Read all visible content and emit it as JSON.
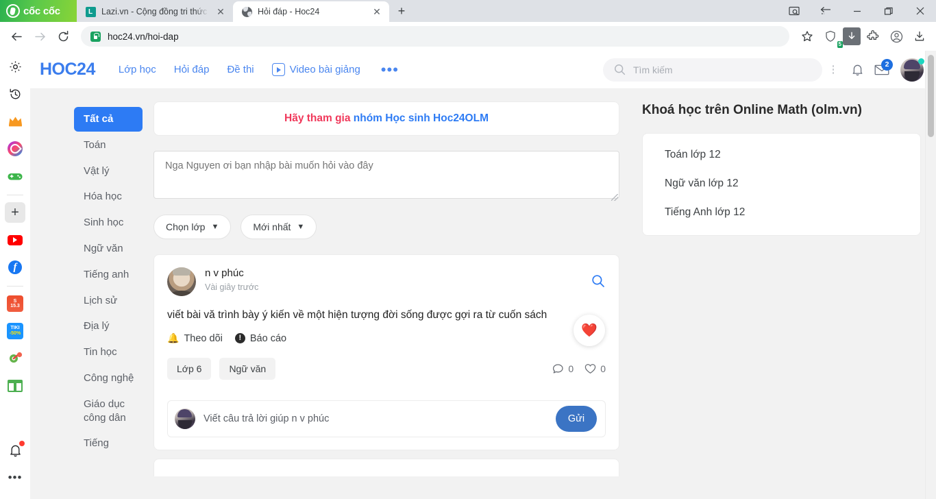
{
  "browser": {
    "logo_text": "cốc cốc",
    "tabs": [
      {
        "title": "Lazi.vn - Cộng đồng tri thức ",
        "favicon": "lazi-letter-icon",
        "active": false
      },
      {
        "title": "Hỏi đáp - Hoc24",
        "favicon": "globe-icon",
        "active": true
      }
    ],
    "new_tab_label": "+",
    "window_controls": [
      "screenshot-icon",
      "sync-icon",
      "minimize-icon",
      "maximize-icon",
      "close-icon"
    ],
    "toolbar": {
      "back_label": "←",
      "forward_label": "→",
      "reload_label": "⟳",
      "url": "hoc24.vn/hoi-dap",
      "shield_count": "5",
      "icons": [
        "bookmark-star-icon",
        "shield-icon",
        "download-icon",
        "extensions-icon",
        "profile-icon",
        "save-icon"
      ]
    }
  },
  "sidepanel": {
    "items": [
      {
        "name": "settings-icon",
        "glyph": "⚙"
      },
      {
        "name": "history-icon",
        "glyph": "↺"
      },
      {
        "name": "crown-icon",
        "glyph": "♛"
      },
      {
        "name": "messenger-icon",
        "glyph": ""
      },
      {
        "name": "game-icon",
        "glyph": "🎮"
      },
      {
        "name": "add-icon",
        "glyph": "+"
      },
      {
        "name": "youtube-icon",
        "glyph": ""
      },
      {
        "name": "facebook-icon",
        "glyph": "f"
      },
      {
        "name": "shopee-icon",
        "glyph": "15.3"
      },
      {
        "name": "tiki-icon",
        "glyph": "-50%"
      },
      {
        "name": "extension-icon",
        "glyph": "🧩"
      },
      {
        "name": "marketplace-icon",
        "glyph": ""
      },
      {
        "name": "notification-bell-icon",
        "glyph": "🔔"
      },
      {
        "name": "more-icon",
        "glyph": "•••"
      }
    ],
    "shopee_top": "S",
    "shopee_bottom": "15.3",
    "tiki_top": "TIKI",
    "tiki_bottom": "-50%"
  },
  "site": {
    "brand": "HOC24",
    "nav": [
      {
        "label": "Lớp học"
      },
      {
        "label": "Hỏi đáp"
      },
      {
        "label": "Đề thi"
      },
      {
        "label": "Video bài giảng",
        "icon": "play-icon"
      }
    ],
    "nav_more": "•••",
    "search_placeholder": "Tìm kiếm",
    "mail_badge": "2"
  },
  "subjects": {
    "items": [
      {
        "label": "Tất cả",
        "active": true
      },
      {
        "label": "Toán",
        "active": false
      },
      {
        "label": "Vật lý",
        "active": false
      },
      {
        "label": "Hóa học",
        "active": false
      },
      {
        "label": "Sinh học",
        "active": false
      },
      {
        "label": "Ngữ văn",
        "active": false
      },
      {
        "label": "Tiếng anh",
        "active": false
      },
      {
        "label": "Lịch sử",
        "active": false
      },
      {
        "label": "Địa lý",
        "active": false
      },
      {
        "label": "Tin học",
        "active": false
      },
      {
        "label": "Công nghệ",
        "active": false
      },
      {
        "label": "Giáo dục công dân",
        "active": false
      },
      {
        "label": "Tiếng",
        "active": false
      }
    ]
  },
  "main": {
    "promo_prefix": "Hãy tham gia ",
    "promo_link": "nhóm Học sinh Hoc24OLM",
    "composer_placeholder": "Nga Nguyen ơi bạn nhập bài muốn hỏi vào đây",
    "composer_value": "",
    "filters": [
      {
        "label": "Chọn lớp"
      },
      {
        "label": "Mới nhất"
      }
    ],
    "question": {
      "author": "n v phúc",
      "time": "Vài giây trước",
      "body": "viết bài vă trình bày ý kiến về một hiện tượng đời sống được gợi ra từ cuốn sách",
      "follow_label": "Theo dõi",
      "report_label": "Báo cáo",
      "reaction_glyph": "❤️",
      "tags": [
        "Lớp 6",
        "Ngữ văn"
      ],
      "comment_count": "0",
      "like_count": "0"
    },
    "reply": {
      "placeholder": "Viết câu trả lời giúp n v phúc",
      "send_label": "Gửi"
    }
  },
  "rightcol": {
    "title": "Khoá học trên Online Math (olm.vn)",
    "links": [
      {
        "label": "Toán lớp 12"
      },
      {
        "label": "Ngữ văn lớp 12"
      },
      {
        "label": "Tiếng Anh lớp 12"
      }
    ]
  },
  "colors": {
    "brand_blue": "#3b7ded",
    "active_blue": "#2d7bf4",
    "promo_red": "#f0395b",
    "send_blue": "#3b74c4"
  }
}
